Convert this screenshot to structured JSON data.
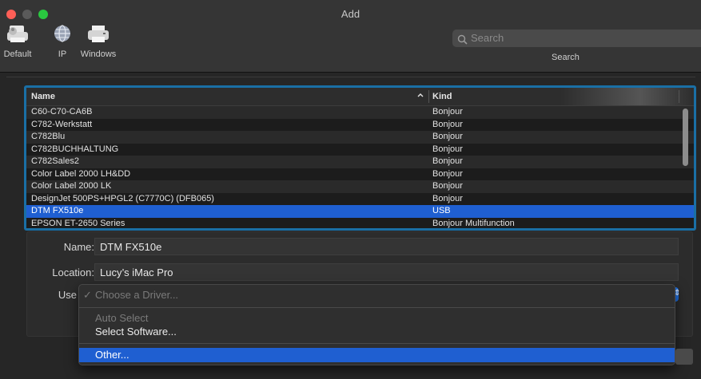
{
  "window": {
    "title": "Add"
  },
  "toolbar": {
    "items": [
      {
        "label": "Default",
        "icon": "default-printer-icon"
      },
      {
        "label": "IP",
        "icon": "globe-icon"
      },
      {
        "label": "Windows",
        "icon": "windows-printer-icon"
      }
    ],
    "search_placeholder": "Search",
    "search_caption": "Search"
  },
  "printer_list": {
    "columns": {
      "name": "Name",
      "kind": "Kind"
    },
    "rows": [
      {
        "name": "C60-C70-CA6B",
        "kind": "Bonjour"
      },
      {
        "name": "C782-Werkstatt",
        "kind": "Bonjour"
      },
      {
        "name": "C782Blu",
        "kind": "Bonjour"
      },
      {
        "name": "C782BUCHHALTUNG",
        "kind": "Bonjour"
      },
      {
        "name": "C782Sales2",
        "kind": "Bonjour"
      },
      {
        "name": "Color Label 2000 LH&DD",
        "kind": "Bonjour"
      },
      {
        "name": "Color Label 2000 LK",
        "kind": "Bonjour"
      },
      {
        "name": "DesignJet 500PS+HPGL2 (C7770C) (DFB065)",
        "kind": "Bonjour"
      },
      {
        "name": "DTM FX510e",
        "kind": "USB",
        "selected": true
      },
      {
        "name": "EPSON ET-2650 Series",
        "kind": "Bonjour Multifunction"
      }
    ]
  },
  "details": {
    "name_label": "Name:",
    "name_value": "DTM FX510e",
    "location_label": "Location:",
    "location_value": "Lucy’s iMac Pro",
    "use_label": "Use"
  },
  "driver_menu": {
    "check_mark": "✓",
    "choose_driver": "Choose a Driver...",
    "auto_select": "Auto Select",
    "select_software": "Select Software...",
    "other": "Other..."
  },
  "colors": {
    "accent": "#1f5fd1",
    "focus_ring": "#1a6fa5"
  }
}
